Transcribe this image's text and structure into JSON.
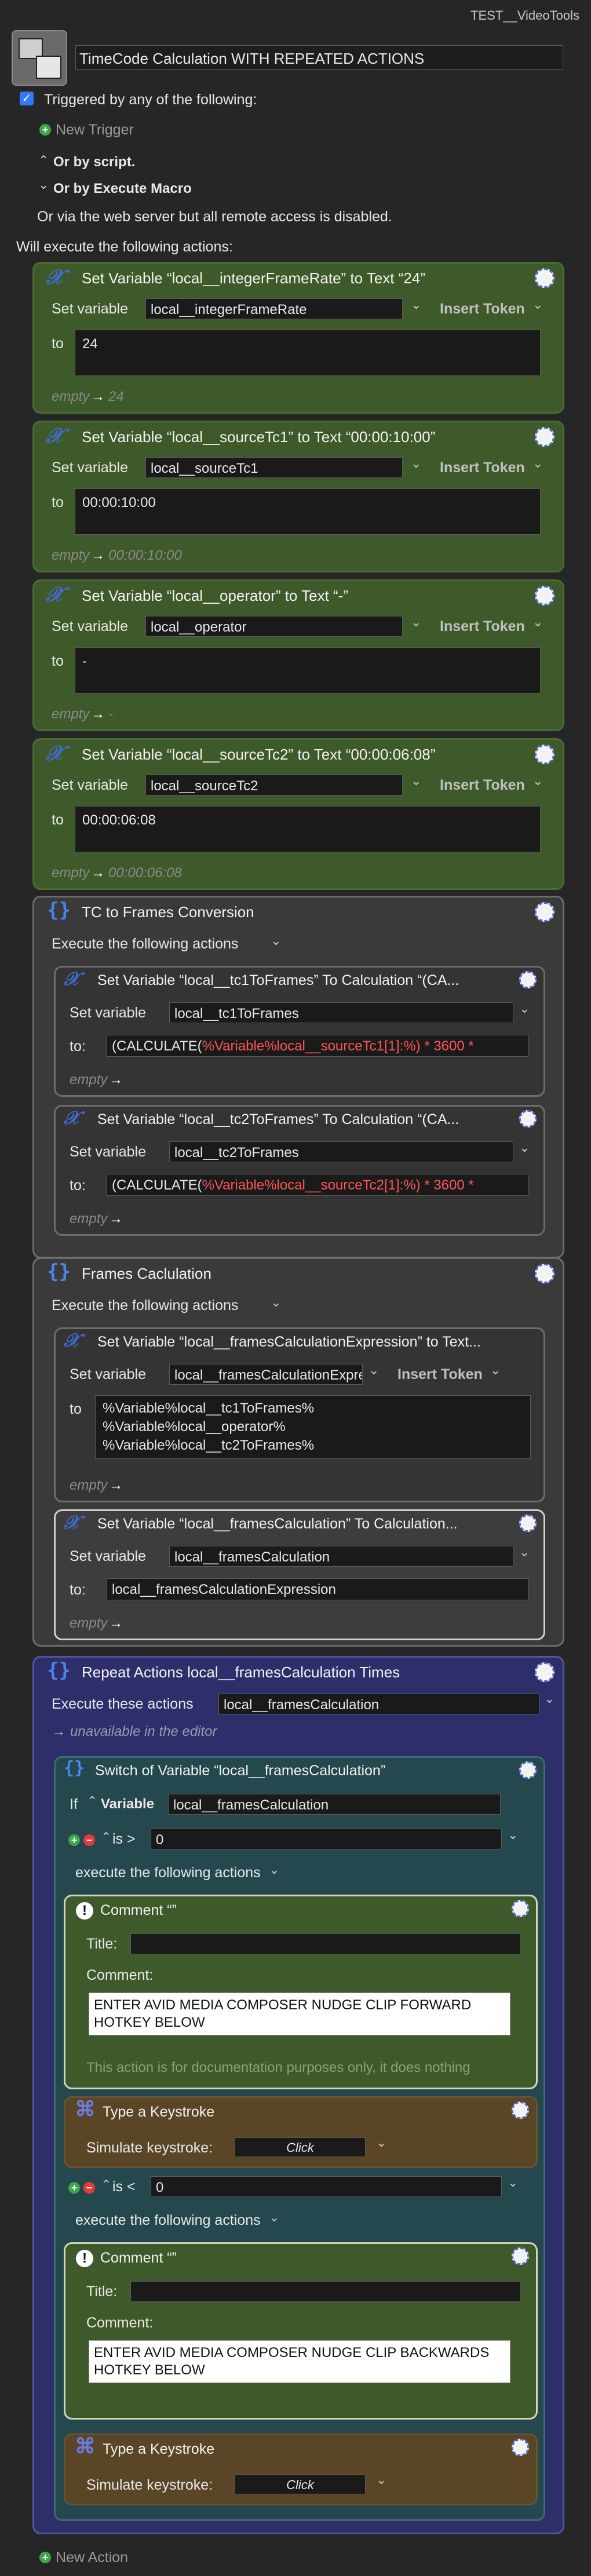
{
  "window_title": "TEST__VideoTools",
  "macro": {
    "name": "TimeCode Calculation WITH REPEATED ACTIONS"
  },
  "trigger": {
    "checkbox_label": "Triggered by any of the following:",
    "new_trigger": "New Trigger",
    "or_script": "Or by script.",
    "or_execute_macro": "Or by Execute Macro",
    "web_server": "Or via the web server but all remote access is disabled."
  },
  "will_execute": "Will execute the following actions:",
  "common": {
    "set_variable": "Set variable",
    "to": "to",
    "to_colon": "to:",
    "insert_token": "Insert Token",
    "empty": "empty",
    "arrow": "→",
    "execute_following": "Execute the following actions",
    "execute_following_lc": "execute the following actions",
    "execute_these": "Execute these actions",
    "title": "Title:",
    "comment": "Comment:",
    "simulate": "Simulate keystroke:",
    "click": "Click",
    "doc_note": "This action is for documentation purposes only, it does nothing",
    "unavailable": "unavailable in the editor",
    "if": "If",
    "variable": "Variable",
    "is_gt": "is >",
    "is_lt": "is <",
    "new_action": "New Action",
    "arrow_sym": "→"
  },
  "actions": [
    {
      "title": "Set Variable “local__integerFrameRate” to Text “24”",
      "var": "local__integerFrameRate",
      "value": "24",
      "preview": "24"
    },
    {
      "title": "Set Variable “local__sourceTc1” to Text “00:00:10:00”",
      "var": "local__sourceTc1",
      "value": "00:00:10:00",
      "preview": "00:00:10:00"
    },
    {
      "title": "Set Variable “local__operator” to Text “-”",
      "var": "local__operator",
      "value": "-",
      "preview": "-"
    },
    {
      "title": "Set Variable “local__sourceTc2” to Text “00:00:06:08”",
      "var": "local__sourceTc2",
      "value": "00:00:06:08",
      "preview": "00:00:06:08"
    }
  ],
  "group1": {
    "title": "TC to Frames Conversion",
    "a1": {
      "title": "Set Variable “local__tc1ToFrames” To Calculation “(CA...",
      "var": "local__tc1ToFrames",
      "calc_prefix": "(CALCULATE(",
      "calc_red": "%Variable%local__sourceTc1[1]:%)",
      "calc_suffix": " * 3600 *"
    },
    "a2": {
      "title": "Set Variable “local__tc2ToFrames” To Calculation “(CA...",
      "var": "local__tc2ToFrames",
      "calc_prefix": "(CALCULATE(",
      "calc_red": "%Variable%local__sourceTc2[1]:%)",
      "calc_suffix": " * 3600 *"
    }
  },
  "group2": {
    "title": "Frames Caclulation",
    "a1": {
      "title": "Set Variable “local__framesCalculationExpression” to Text...",
      "var": "local__framesCalculationExpre",
      "lines": [
        "%Variable%local__tc1ToFrames%",
        "%Variable%local__operator%",
        "%Variable%local__tc2ToFrames%"
      ]
    },
    "a2": {
      "title": "Set Variable “local__framesCalculation” To Calculation...",
      "var": "local__framesCalculation",
      "calc": "local__framesCalculationExpression"
    }
  },
  "repeat": {
    "title": "Repeat Actions local__framesCalculation Times",
    "count": "local__framesCalculation",
    "switch": {
      "title": "Switch of Variable “local__framesCalculation”",
      "var": "local__framesCalculation",
      "v1": "0",
      "v2": "0",
      "comment1": {
        "title": "Comment “”",
        "text": "ENTER AVID MEDIA COMPOSER NUDGE CLIP FORWARD HOTKEY BELOW"
      },
      "comment2": {
        "title": "Comment “”",
        "text": "ENTER AVID MEDIA COMPOSER NUDGE CLIP BACKWARDS HOTKEY BELOW"
      },
      "keystroke_title": "Type a Keystroke"
    }
  }
}
